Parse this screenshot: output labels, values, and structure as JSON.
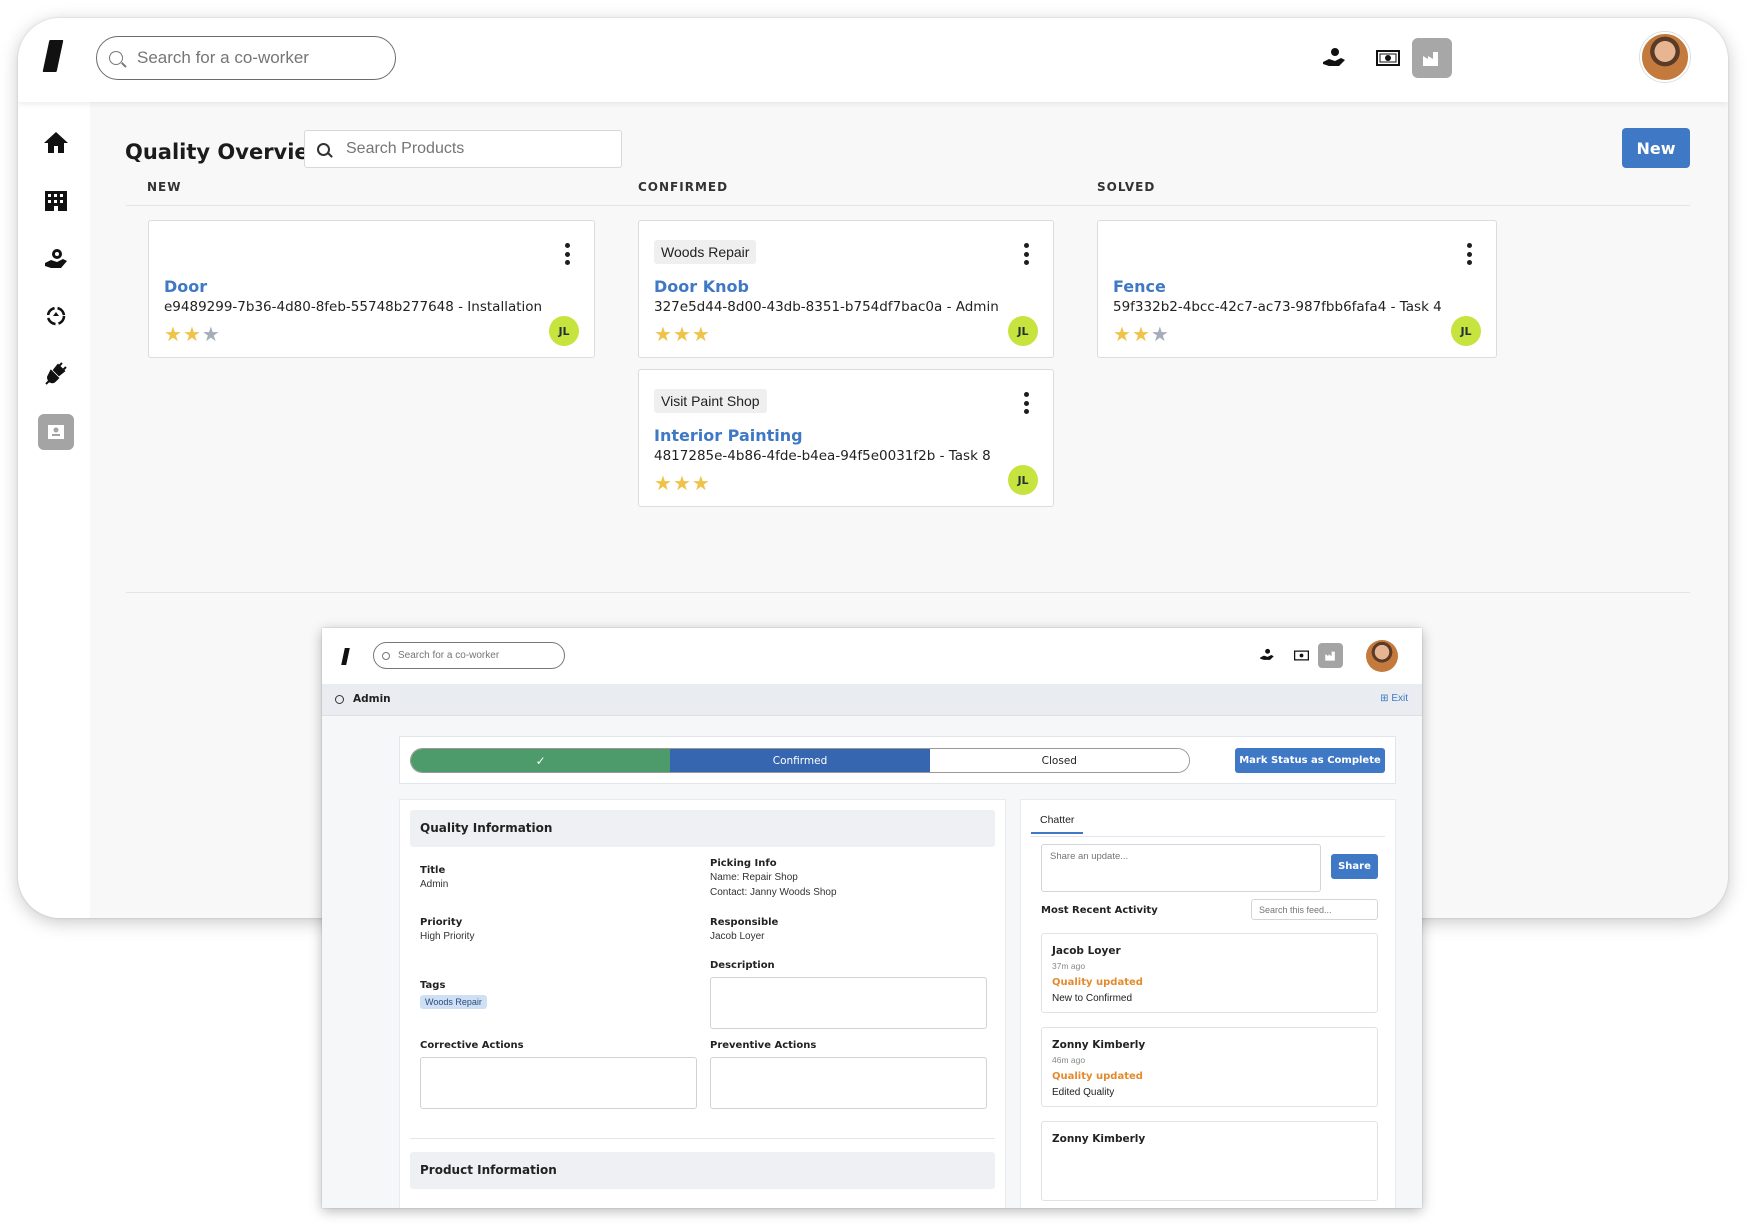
{
  "app": {
    "coworker_search_placeholder": "Search for a co-worker",
    "top_icons": [
      "hand-coin-icon",
      "money-bill-icon",
      "factory-icon"
    ],
    "sidebar_icons": [
      "home-icon",
      "building-icon",
      "hand-gear-icon",
      "recycle-icon",
      "plug-icon",
      "badge-icon"
    ]
  },
  "quality": {
    "title": "Quality Overview",
    "search_placeholder": "Search Products",
    "new_label": "New",
    "columns": [
      {
        "label": "NEW"
      },
      {
        "label": "CONFIRMED"
      },
      {
        "label": "SOLVED"
      }
    ],
    "cards": [
      {
        "column": "NEW",
        "tag": "",
        "name": "Door",
        "meta": "e9489299-7b36-4d80-8feb-55748b277648 - Installation",
        "rating": 2,
        "max_rating": 3,
        "assignee": "JL"
      },
      {
        "column": "CONFIRMED",
        "tag": "Woods Repair",
        "name": "Door Knob",
        "meta": "327e5d44-8d00-43db-8351-b754df7bac0a - Admin",
        "rating": 3,
        "max_rating": 3,
        "assignee": "JL"
      },
      {
        "column": "SOLVED",
        "tag": "",
        "name": "Fence",
        "meta": "59f332b2-4bcc-42c7-ac73-987fbb6fafa4 - Task 4",
        "rating": 2,
        "max_rating": 3,
        "assignee": "JL"
      },
      {
        "column": "CONFIRMED",
        "tag": "Visit Paint Shop",
        "name": "Interior Painting",
        "meta": "4817285e-4b86-4fde-b4ea-94f5e0031f2b - Task 8",
        "rating": 3,
        "max_rating": 3,
        "assignee": "JL"
      }
    ],
    "colors": {
      "accent": "#3f78c4",
      "star_on": "#efc34a",
      "star_off": "#a5adb8",
      "assignee_bg": "#c7e33e"
    }
  },
  "detail": {
    "coworker_search_placeholder": "Search for a co-worker",
    "header_title": "Admin",
    "exit_label": "Exit",
    "stages": [
      {
        "label": "✓",
        "state": "done"
      },
      {
        "label": "Confirmed",
        "state": "current"
      },
      {
        "label": "Closed",
        "state": "next"
      }
    ],
    "mark_complete_label": "Mark Status as Complete",
    "quality_info": {
      "heading": "Quality Information",
      "title_label": "Title",
      "title_value": "Admin",
      "picking_label": "Picking Info",
      "picking_name": "Name: Repair Shop",
      "picking_contact": "Contact: Janny Woods Shop",
      "priority_label": "Priority",
      "priority_value": "High Priority",
      "responsible_label": "Responsible",
      "responsible_value": "Jacob Loyer",
      "description_label": "Description",
      "tags_label": "Tags",
      "tag_value": "Woods Repair",
      "corrective_label": "Corrective Actions",
      "preventive_label": "Preventive Actions"
    },
    "product_info_heading": "Product Information",
    "chatter": {
      "tab_label": "Chatter",
      "share_placeholder": "Share an update...",
      "share_label": "Share",
      "recent_label": "Most Recent Activity",
      "feed_search_placeholder": "Search this feed...",
      "activities": [
        {
          "who": "Jacob Loyer",
          "ago": "37m ago",
          "update": "Quality updated",
          "detail": "New to Confirmed"
        },
        {
          "who": "Zonny Kimberly",
          "ago": "46m ago",
          "update": "Quality updated",
          "detail": "Edited Quality"
        },
        {
          "who": "Zonny Kimberly",
          "ago": "",
          "update": "",
          "detail": ""
        }
      ]
    }
  }
}
